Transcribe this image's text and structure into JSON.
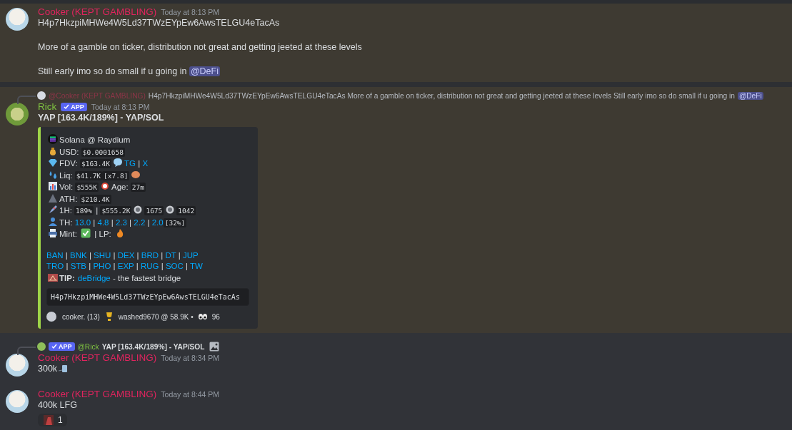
{
  "messages": [
    {
      "highlighted": true,
      "author": "Cooker (KEPT GAMBLING)",
      "color": "#e0245e",
      "timestamp": "Today at 8:13 PM",
      "paragraphs": [
        [
          {
            "kind": "text",
            "text": "H4p7HkzpiMHWe4W5Ld37TWzEYpEw6AwsTELGU4eTacAs"
          }
        ],
        [
          {
            "kind": "text",
            "text": "More of a gamble on ticker, distribution not great and getting jeeted at these levels"
          }
        ],
        [
          {
            "kind": "text",
            "text": "Still early imo so do small if u going in "
          },
          {
            "kind": "mention",
            "text": "@DeFi"
          }
        ]
      ]
    },
    {
      "highlighted": true,
      "reply": {
        "author": "@Cooker (KEPT GAMBLING)",
        "color": "#8c3548",
        "segments": [
          {
            "kind": "text",
            "text": "H4p7HkzpiMHWe4W5Ld37TWzEYpEw6AwsTELGU4eTacAs  More of a gamble on ticker, distribution not great and getting jeeted at these levels  Still early imo so do small if u going in "
          },
          {
            "kind": "mention",
            "text": "@DeFi"
          }
        ]
      },
      "author": "Rick",
      "color": "#7fc241",
      "badge": "APP",
      "timestamp": "Today at 8:13 PM",
      "paragraphs": [
        [
          {
            "kind": "bold",
            "text": "YAP [163.4K/189%] - YAP/SOL"
          }
        ]
      ],
      "embed": {
        "lines": [
          [
            {
              "kind": "icon"
            },
            {
              "kind": "text",
              "text": "Solana @ Raydium"
            }
          ],
          [
            {
              "kind": "icon"
            },
            {
              "kind": "text",
              "text": "USD: "
            },
            {
              "kind": "code",
              "text": "$0.0001658"
            }
          ],
          [
            {
              "kind": "icon"
            },
            {
              "kind": "text",
              "text": "FDV: "
            },
            {
              "kind": "code",
              "text": "$163.4K"
            },
            {
              "kind": "icon"
            },
            {
              "kind": "link",
              "text": "TG"
            },
            {
              "kind": "text",
              "text": " | "
            },
            {
              "kind": "link",
              "text": "X"
            }
          ],
          [
            {
              "kind": "icon"
            },
            {
              "kind": "text",
              "text": "Liq: "
            },
            {
              "kind": "code",
              "text": "$41.7K"
            },
            {
              "kind": "code",
              "text": "[x7.8]"
            },
            {
              "kind": "icon"
            }
          ],
          [
            {
              "kind": "icon"
            },
            {
              "kind": "text",
              "text": "Vol: "
            },
            {
              "kind": "code",
              "text": "$555K"
            },
            {
              "kind": "icon"
            },
            {
              "kind": "text",
              "text": "Age: "
            },
            {
              "kind": "code",
              "text": "27m"
            }
          ],
          [
            {
              "kind": "icon"
            },
            {
              "kind": "text",
              "text": "ATH: "
            },
            {
              "kind": "code",
              "text": "$210.4K"
            }
          ],
          [
            {
              "kind": "icon"
            },
            {
              "kind": "text",
              "text": "1H: "
            },
            {
              "kind": "code",
              "text": "189%"
            },
            {
              "kind": "text",
              "text": " | "
            },
            {
              "kind": "code",
              "text": "$555.2K"
            },
            {
              "kind": "icon"
            },
            {
              "kind": "code",
              "text": "1675"
            },
            {
              "kind": "icon"
            },
            {
              "kind": "code",
              "text": "1042"
            }
          ],
          [
            {
              "kind": "icon"
            },
            {
              "kind": "text",
              "text": "TH: "
            },
            {
              "kind": "link",
              "text": "13.0"
            },
            {
              "kind": "text",
              "text": " | "
            },
            {
              "kind": "link",
              "text": "4.8"
            },
            {
              "kind": "text",
              "text": " | "
            },
            {
              "kind": "link",
              "text": "2.3"
            },
            {
              "kind": "text",
              "text": " | "
            },
            {
              "kind": "link",
              "text": "2.2"
            },
            {
              "kind": "text",
              "text": " | "
            },
            {
              "kind": "link",
              "text": "2.0"
            },
            {
              "kind": "code",
              "text": "[32%]"
            }
          ],
          [
            {
              "kind": "icon"
            },
            {
              "kind": "text",
              "text": "Mint: "
            },
            {
              "kind": "icon"
            },
            {
              "kind": "text",
              "text": " | LP: "
            },
            {
              "kind": "icon"
            }
          ]
        ],
        "link_lines": [
          [
            {
              "kind": "link",
              "text": "BAN"
            },
            {
              "kind": "text",
              "text": " | "
            },
            {
              "kind": "link",
              "text": "BNK"
            },
            {
              "kind": "text",
              "text": " | "
            },
            {
              "kind": "link",
              "text": "SHU"
            },
            {
              "kind": "text",
              "text": " | "
            },
            {
              "kind": "link",
              "text": "DEX"
            },
            {
              "kind": "text",
              "text": " | "
            },
            {
              "kind": "link",
              "text": "BRD"
            },
            {
              "kind": "text",
              "text": " | "
            },
            {
              "kind": "link",
              "text": "DT"
            },
            {
              "kind": "text",
              "text": " | "
            },
            {
              "kind": "link",
              "text": "JUP"
            }
          ],
          [
            {
              "kind": "link",
              "text": "TRO"
            },
            {
              "kind": "text",
              "text": " | "
            },
            {
              "kind": "link",
              "text": "STB"
            },
            {
              "kind": "text",
              "text": " | "
            },
            {
              "kind": "link",
              "text": "PHO"
            },
            {
              "kind": "text",
              "text": " | "
            },
            {
              "kind": "link",
              "text": "EXP"
            },
            {
              "kind": "text",
              "text": " | "
            },
            {
              "kind": "link",
              "text": "RUG"
            },
            {
              "kind": "text",
              "text": " | "
            },
            {
              "kind": "link",
              "text": "SOC"
            },
            {
              "kind": "text",
              "text": " | "
            },
            {
              "kind": "link",
              "text": "TW"
            }
          ],
          [
            {
              "kind": "icon"
            },
            {
              "kind": "bold",
              "text": "TIP:"
            },
            {
              "kind": "link",
              "text": "deBridge"
            },
            {
              "kind": "text",
              "text": " - the fastest bridge"
            }
          ]
        ],
        "code_block": "H4p7HkzpiMHWe4W5Ld37TWzEYpEw6AwsTELGU4eTacAs",
        "footer": [
          {
            "kind": "text",
            "text": "cooker. (13)"
          },
          {
            "kind": "icon"
          },
          {
            "kind": "text",
            "text": "washed9670 @ 58.9K •"
          },
          {
            "kind": "icon"
          },
          {
            "kind": "text",
            "text": "96"
          }
        ]
      }
    },
    {
      "highlighted": false,
      "reply": {
        "author": "@Rick",
        "color": "#7fc241",
        "badge": "APP",
        "segments": [
          {
            "kind": "text",
            "text": "YAP [163.4K/189%] - YAP/SOL"
          },
          {
            "kind": "icon"
          }
        ]
      },
      "author": "Cooker (KEPT GAMBLING)",
      "color": "#e0245e",
      "timestamp": "Today at 8:34 PM",
      "paragraphs": [
        [
          {
            "kind": "text",
            "text": "300k"
          },
          {
            "kind": "icon"
          }
        ]
      ]
    },
    {
      "highlighted": false,
      "author": "Cooker (KEPT GAMBLING)",
      "color": "#e0245e",
      "timestamp": "Today at 8:44 PM",
      "paragraphs": [
        [
          {
            "kind": "text",
            "text": "400k LFG"
          }
        ]
      ],
      "reactions": [
        {
          "count": "1"
        }
      ]
    }
  ]
}
